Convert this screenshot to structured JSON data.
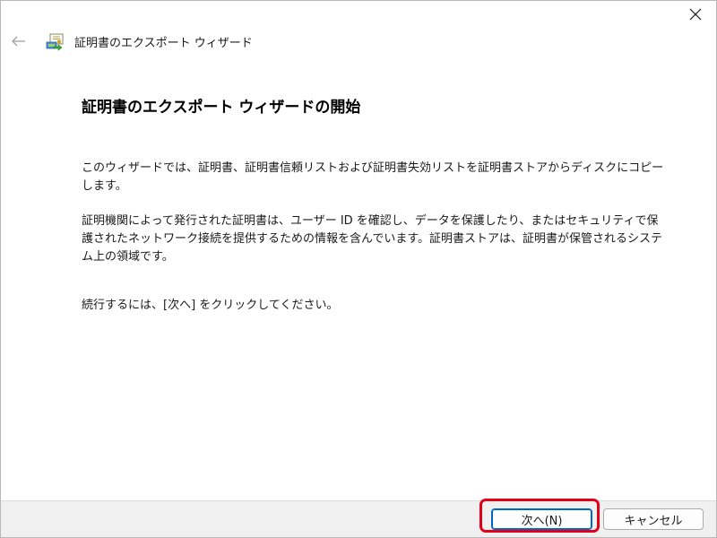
{
  "header": {
    "title": "証明書のエクスポート ウィザード"
  },
  "main": {
    "heading": "証明書のエクスポート ウィザードの開始",
    "paragraph1": "このウィザードでは、証明書、証明書信頼リストおよび証明書失効リストを証明書ストアからディスクにコピーします。",
    "paragraph2": "証明機関によって発行された証明書は、ユーザー ID を確認し、データを保護したり、またはセキュリティで保護されたネットワーク接続を提供するための情報を含んでいます。証明書ストアは、証明書が保管されるシステム上の領域です。",
    "paragraph3": "続行するには、[次へ] をクリックしてください。"
  },
  "footer": {
    "next_label": "次へ(N)",
    "cancel_label": "キャンセル"
  },
  "colors": {
    "highlight": "#e2001a",
    "default_button_border": "#0067c0",
    "footer_bg": "#f0f0f0"
  },
  "icons": {
    "close": "close-icon",
    "back": "back-arrow-icon",
    "wizard": "certificate-wizard-icon"
  }
}
